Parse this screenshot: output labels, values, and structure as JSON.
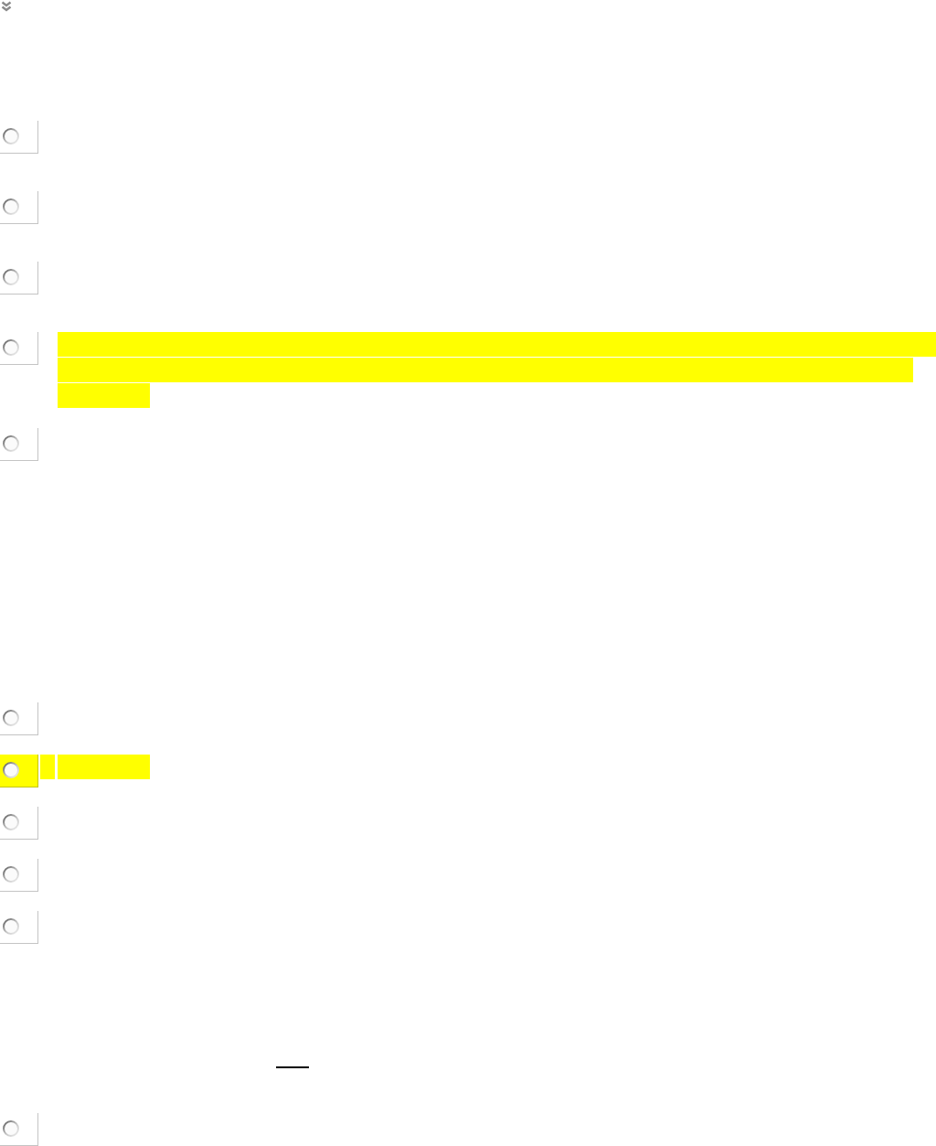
{
  "questions": [
    {
      "kind": "choice",
      "options": [
        {
          "selected": false,
          "tile_highlighted": false
        },
        {
          "selected": false,
          "tile_highlighted": false
        },
        {
          "selected": false,
          "tile_highlighted": false
        },
        {
          "selected": false,
          "tile_highlighted": false,
          "highlight_lines": [
            {
              "kind": "full"
            },
            {
              "kind": "long"
            },
            {
              "kind": "short"
            }
          ]
        },
        {
          "selected": false,
          "tile_highlighted": false
        }
      ]
    },
    {
      "kind": "choice",
      "options": [
        {
          "selected": false,
          "tile_highlighted": false
        },
        {
          "selected": false,
          "tile_highlighted": true,
          "highlight_lines": [
            {
              "kind": "short"
            }
          ]
        },
        {
          "selected": false,
          "tile_highlighted": false
        },
        {
          "selected": false,
          "tile_highlighted": false
        },
        {
          "selected": false,
          "tile_highlighted": false
        }
      ]
    },
    {
      "kind": "blank"
    },
    {
      "kind": "choice",
      "options": [
        {
          "selected": false,
          "tile_highlighted": false
        }
      ]
    }
  ]
}
